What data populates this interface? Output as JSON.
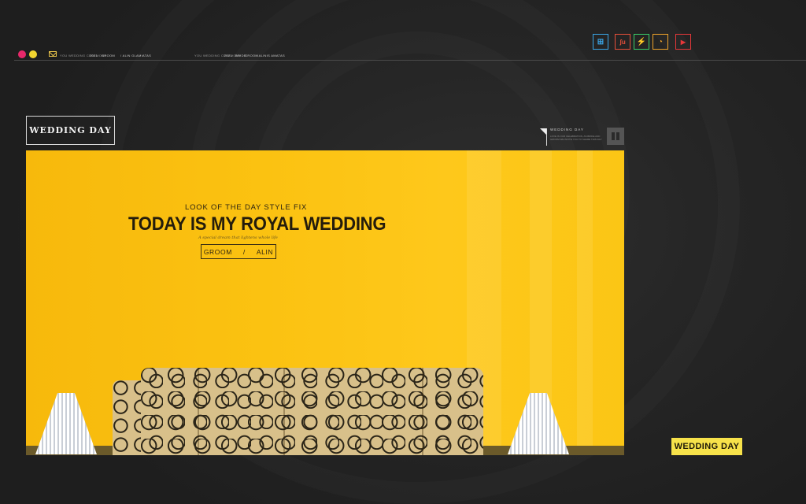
{
  "topbar": {
    "meta_left": [
      "YOU WEDDING CEREMONY",
      "2021",
      "GROOM",
      "/ ALIN GLAMIATAS"
    ],
    "meta_right": [
      "YOU WEDDING CEREMONY",
      "2021",
      "BRIDE",
      "GROOM",
      "/ ALINIS AMATAS"
    ]
  },
  "social": [
    {
      "icon": "windows-icon",
      "glyph": "⊞",
      "color": "#3aa6e8"
    },
    {
      "icon": "stumbleupon-icon",
      "glyph": "ʃu",
      "color": "#e8503a"
    },
    {
      "icon": "lightning-icon",
      "glyph": "⚡",
      "color": "#3ad06a"
    },
    {
      "icon": "rss-icon",
      "glyph": "◔",
      "color": "#f0a32a"
    },
    {
      "icon": "youtube-icon",
      "glyph": "▶",
      "color": "#e8383a"
    }
  ],
  "header": {
    "title": "WEDDING DAY"
  },
  "side": {
    "title": "WEDDING   DAY",
    "text": "LOVE IS OUR CELEBRATION, AS BRIDE AND GROOM WE INVITE YOU TO SHARE THIS DAY"
  },
  "hero": {
    "subtitle": "LOOK  OF THE DAY STYLE FIX",
    "title": "TODAY IS MY ROYAL WEDDING",
    "tagline": "A  special dream that lightens whole life",
    "btn_left": "GROOM",
    "btn_sep": "/",
    "btn_right": "ALIN"
  },
  "bottom_tag": "WEDDING DAY",
  "colors": {
    "dot_pink": "#e8286a",
    "dot_yellow": "#f2d530",
    "hero_yellow": "#fbc211",
    "tag_yellow": "#f7e24a"
  }
}
